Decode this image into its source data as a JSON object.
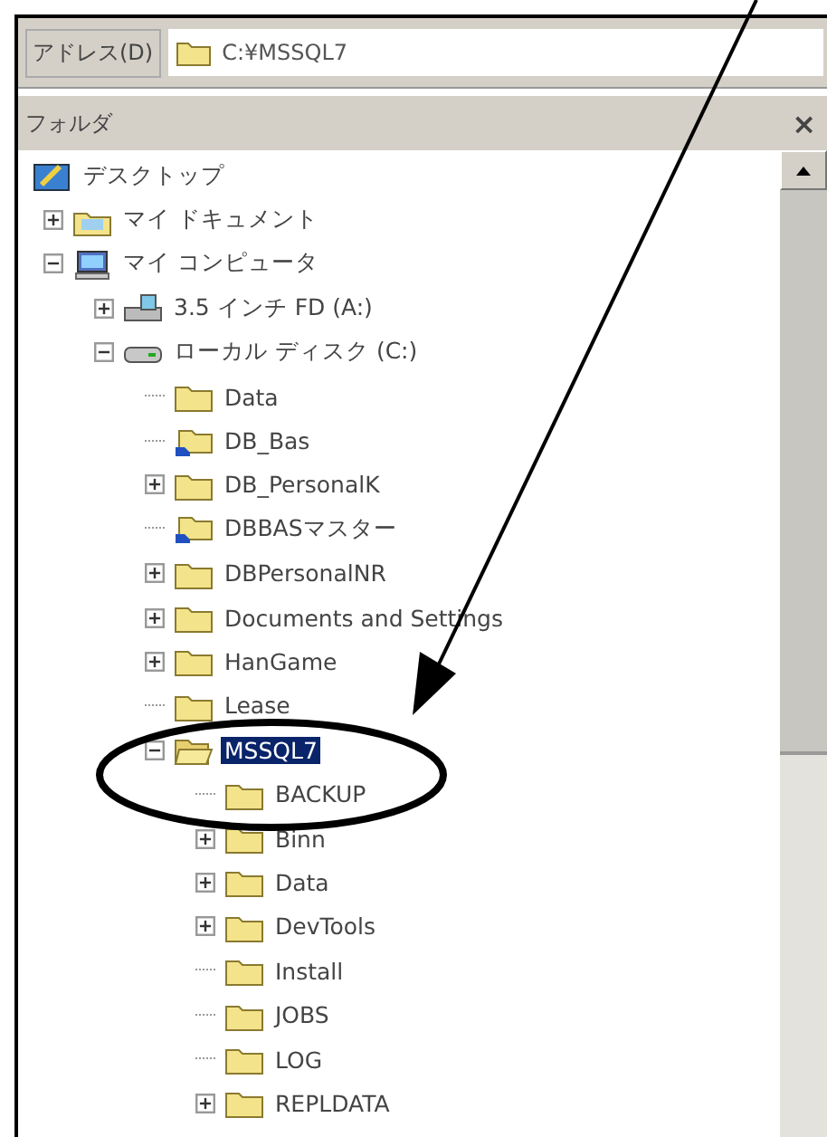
{
  "address_bar": {
    "label": "アドレス(D)",
    "value": "C:¥MSSQL7"
  },
  "folder_pane": {
    "title": "フォルダ",
    "close": "×"
  },
  "tree": [
    {
      "label": "デスクトップ",
      "kind": "desktop",
      "selected": false,
      "children": [
        {
          "label": "マイ ドキュメント",
          "kind": "documents",
          "expanded": false,
          "selected": false
        },
        {
          "label": "マイ コンピュータ",
          "kind": "computer",
          "expanded": true,
          "selected": false,
          "children": [
            {
              "label": "3.5 インチ FD (A:)",
              "kind": "floppy",
              "expanded": false,
              "selected": false
            },
            {
              "label": "ローカル ディスク (C:)",
              "kind": "drive",
              "expanded": true,
              "selected": false,
              "children": [
                {
                  "label": "Data",
                  "kind": "folder",
                  "selected": false
                },
                {
                  "label": "DB_Bas",
                  "kind": "shared-folder",
                  "selected": false
                },
                {
                  "label": "DB_PersonalK",
                  "kind": "folder",
                  "expanded": false,
                  "selected": false
                },
                {
                  "label": "DBBASマスター",
                  "kind": "shared-folder",
                  "selected": false
                },
                {
                  "label": "DBPersonalNR",
                  "kind": "folder",
                  "expanded": false,
                  "selected": false
                },
                {
                  "label": "Documents and Settings",
                  "kind": "folder",
                  "expanded": false,
                  "selected": false
                },
                {
                  "label": "HanGame",
                  "kind": "folder",
                  "expanded": false,
                  "selected": false
                },
                {
                  "label": "Lease",
                  "kind": "folder",
                  "selected": false
                },
                {
                  "label": "MSSQL7",
                  "kind": "open-folder",
                  "expanded": true,
                  "selected": true,
                  "children": [
                    {
                      "label": "BACKUP",
                      "kind": "folder",
                      "selected": false
                    },
                    {
                      "label": "Binn",
                      "kind": "folder",
                      "expanded": false,
                      "selected": false
                    },
                    {
                      "label": "Data",
                      "kind": "folder",
                      "expanded": false,
                      "selected": false
                    },
                    {
                      "label": "DevTools",
                      "kind": "folder",
                      "expanded": false,
                      "selected": false
                    },
                    {
                      "label": "Install",
                      "kind": "folder",
                      "selected": false
                    },
                    {
                      "label": "JOBS",
                      "kind": "folder",
                      "selected": false
                    },
                    {
                      "label": "LOG",
                      "kind": "folder",
                      "selected": false
                    },
                    {
                      "label": "REPLDATA",
                      "kind": "folder",
                      "expanded": false,
                      "selected": false
                    }
                  ]
                }
              ]
            }
          ]
        }
      ]
    }
  ]
}
